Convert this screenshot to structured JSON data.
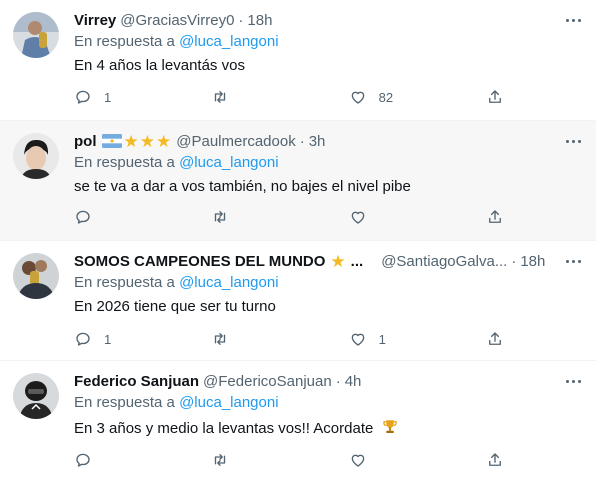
{
  "reply_label": "En respuesta a",
  "tweets": [
    {
      "name": "Virrey",
      "handle": "@GraciasVirrey0",
      "time": "18h",
      "mention": "@luca_langoni",
      "text": "En 4 años la levantás vos",
      "replies": "1",
      "retweets": "",
      "likes": "82"
    },
    {
      "name": "pol",
      "handle": "@Paulmercadook",
      "time": "3h",
      "mention": "@luca_langoni",
      "text": "se te va a dar a vos también, no bajes el nivel pibe",
      "replies": "",
      "retweets": "",
      "likes": "",
      "name_decoration": "argentina-flag-and-three-stars"
    },
    {
      "name": "SOMOS CAMPEONES DEL MUNDO",
      "name_suffix": "...",
      "handle": "@SantiagoGalva...",
      "time": "18h",
      "mention": "@luca_langoni",
      "text": "En 2026 tiene que ser tu turno",
      "replies": "1",
      "retweets": "",
      "likes": "1"
    },
    {
      "name": "Federico Sanjuan",
      "handle": "@FedericoSanjuan",
      "time": "4h",
      "mention": "@luca_langoni",
      "text": "En 3 años y medio la levantas vos!! Acordate",
      "replies": "",
      "retweets": "",
      "likes": "",
      "text_emoji": "trophy-icon"
    }
  ],
  "colors": {
    "link": "#1d9bf0",
    "secondary_text": "#536471",
    "highlight_background": "#f7f7f7",
    "star": "#f5b921"
  }
}
